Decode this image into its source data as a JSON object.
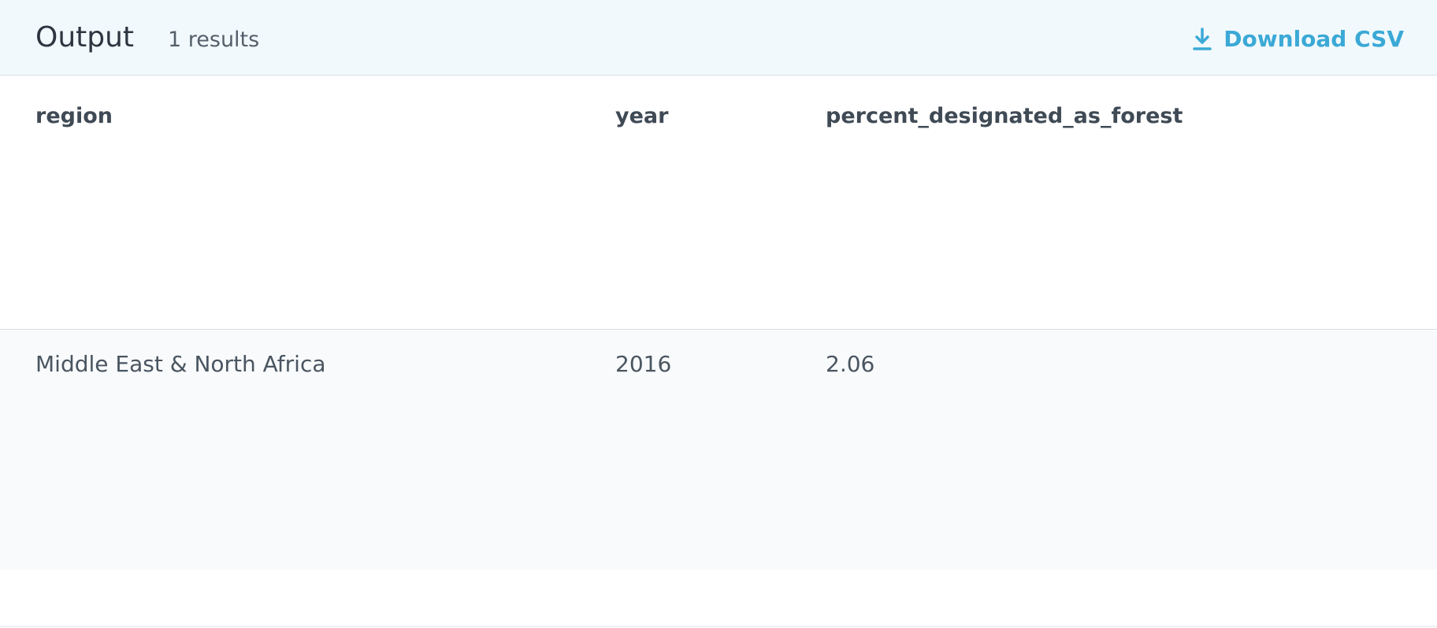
{
  "header": {
    "title": "Output",
    "count": "1 results",
    "download_label": "Download CSV"
  },
  "table": {
    "columns": [
      "region",
      "year",
      "percent_designated_as_forest"
    ],
    "rows": [
      [
        "Middle East & North Africa",
        "2016",
        "2.06"
      ]
    ]
  },
  "colors": {
    "accent": "#3ba9d6",
    "header_bg": "#f1f9fc",
    "row_bg": "#f8fafc"
  },
  "icons": {
    "download": "download-icon"
  }
}
